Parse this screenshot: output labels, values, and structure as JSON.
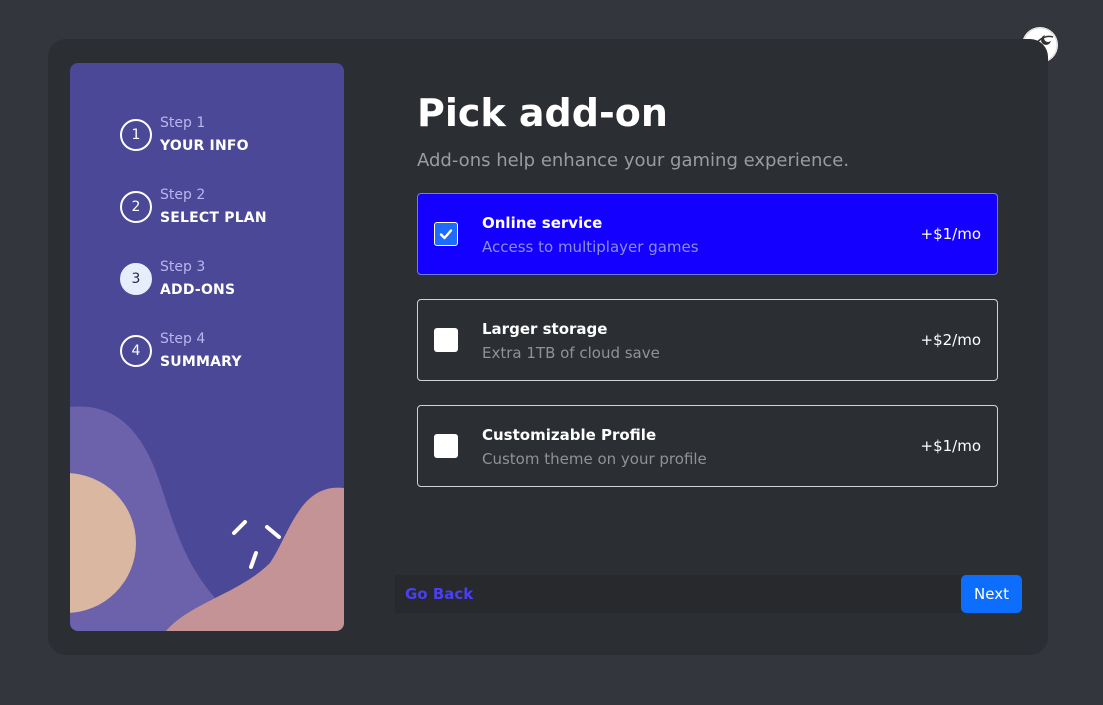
{
  "steps": [
    {
      "label": "Step 1",
      "title": "YOUR INFO",
      "number": "1",
      "active": false
    },
    {
      "label": "Step 2",
      "title": "SELECT PLAN",
      "number": "2",
      "active": false
    },
    {
      "label": "Step 3",
      "title": "ADD-ONS",
      "number": "3",
      "active": true
    },
    {
      "label": "Step 4",
      "title": "SUMMARY",
      "number": "4",
      "active": false
    }
  ],
  "main": {
    "title": "Pick add-on",
    "subtitle": "Add-ons help enhance your gaming experience."
  },
  "addons": [
    {
      "name": "Online service",
      "description": "Access to multiplayer games",
      "price": "+$1/mo",
      "checked": true
    },
    {
      "name": "Larger storage",
      "description": "Extra 1TB of cloud save",
      "price": "+$2/mo",
      "checked": false
    },
    {
      "name": "Customizable Profile",
      "description": "Custom theme on your profile",
      "price": "+$1/mo",
      "checked": false
    }
  ],
  "footer": {
    "back_label": "Go Back",
    "next_label": "Next"
  },
  "colors": {
    "sidebar": "#4b4897",
    "selected_addon": "#1400ff",
    "next_button": "#0d6efd",
    "go_back": "#4a3ff3"
  },
  "icons": {
    "theme_toggle": "theme-toggle-icon",
    "checkmark": "checkmark-icon"
  }
}
